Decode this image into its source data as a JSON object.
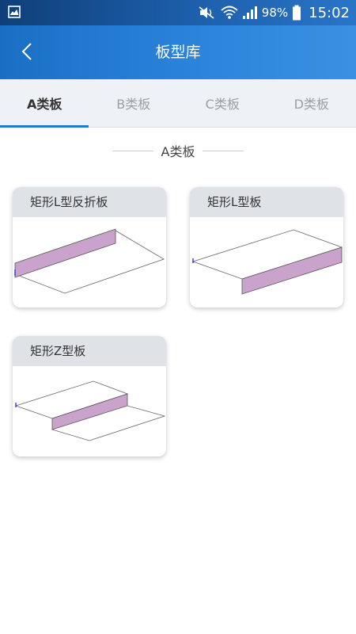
{
  "status_bar": {
    "battery": "98%",
    "time": "15:02"
  },
  "header": {
    "title": "板型库"
  },
  "tabs": [
    {
      "label": "A类板",
      "active": true
    },
    {
      "label": "B类板",
      "active": false
    },
    {
      "label": "C类板",
      "active": false
    },
    {
      "label": "D类板",
      "active": false
    }
  ],
  "section": {
    "title": "A类板"
  },
  "cards": [
    {
      "label": "矩形L型反折板",
      "figure": "l-fold-back-plate"
    },
    {
      "label": "矩形L型板",
      "figure": "l-plate"
    },
    {
      "label": "矩形Z型板",
      "figure": "z-plate"
    }
  ],
  "colors": {
    "header": "#2478d0",
    "plate_fill": "#c9a3cc",
    "active_indicator": "#2478d0"
  }
}
